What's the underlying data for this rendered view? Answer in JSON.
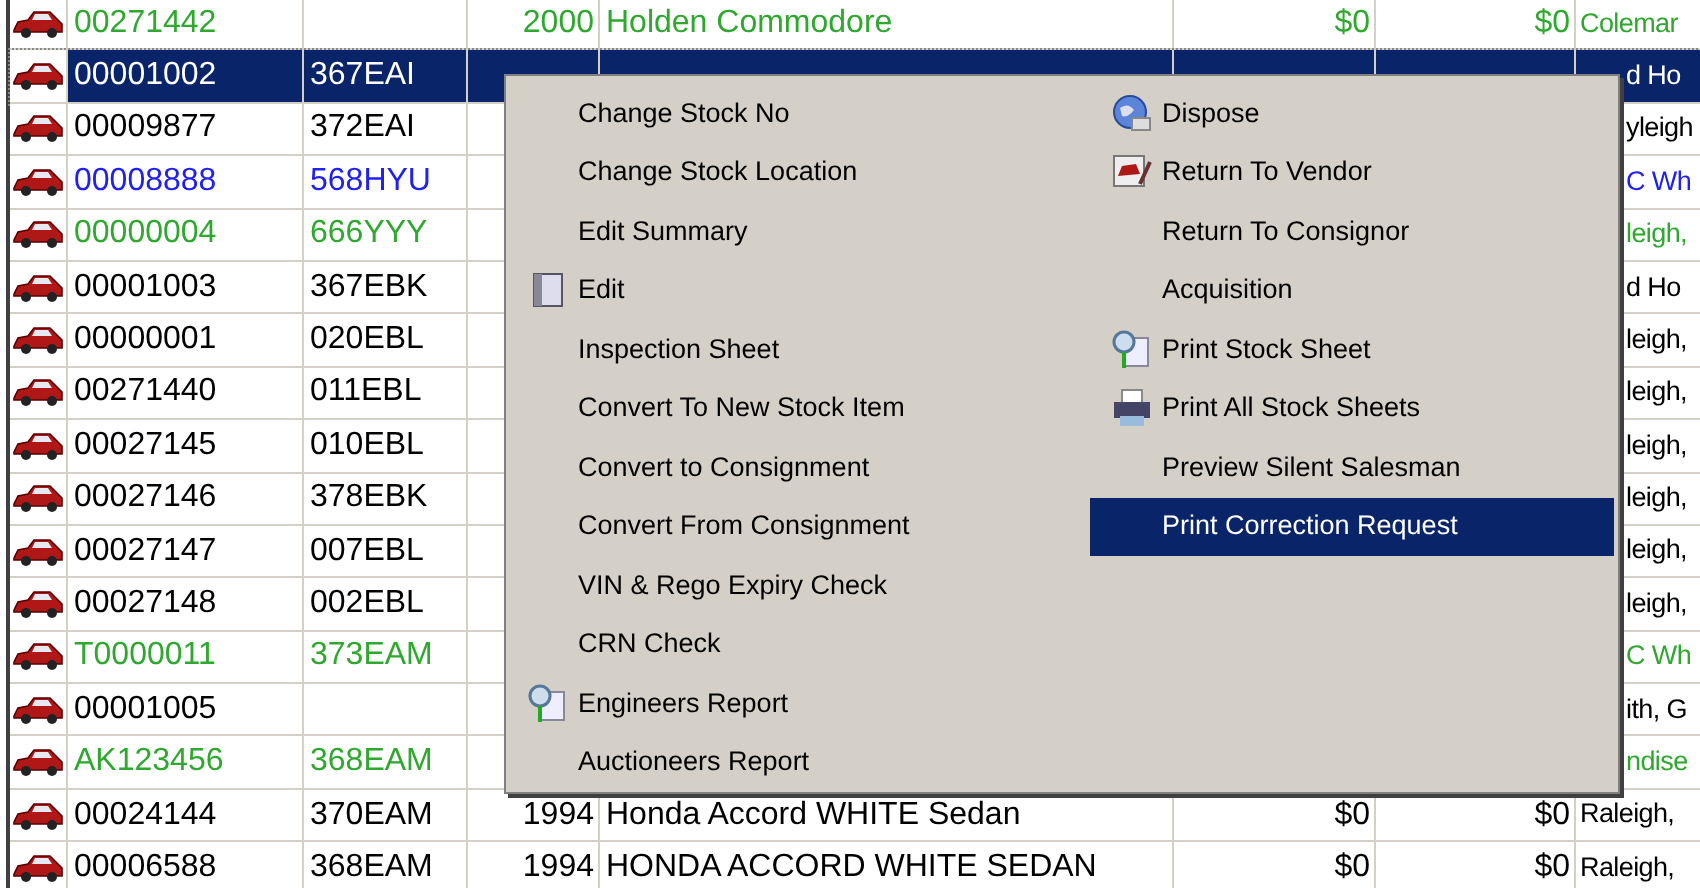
{
  "rows": [
    {
      "stock_no": "00271442",
      "rego": "",
      "year": "2000",
      "model": "Holden Commodore",
      "price_1": "$0",
      "price_2": "$0",
      "owner": "Colemar",
      "color": "#2ea82e",
      "selected": false,
      "covered": false
    },
    {
      "stock_no": "00001002",
      "rego": "367EAI",
      "owner": "d Ho",
      "selected": true,
      "covered": true
    },
    {
      "stock_no": "00009877",
      "rego": "372EAI",
      "owner": "yleigh",
      "color": "#000000",
      "selected": false,
      "covered": true
    },
    {
      "stock_no": "00008888",
      "rego": "568HYU",
      "owner": "C Wh",
      "color": "#2020f0",
      "selected": false,
      "covered": true
    },
    {
      "stock_no": "00000004",
      "rego": "666YYY",
      "owner": "leigh,",
      "color": "#2ea82e",
      "selected": false,
      "covered": true
    },
    {
      "stock_no": "00001003",
      "rego": "367EBK",
      "owner": "d Ho",
      "color": "#000000",
      "selected": false,
      "covered": true
    },
    {
      "stock_no": "00000001",
      "rego": "020EBL",
      "owner": "leigh,",
      "color": "#000000",
      "selected": false,
      "covered": true
    },
    {
      "stock_no": "00271440",
      "rego": "011EBL",
      "owner": "leigh,",
      "color": "#000000",
      "selected": false,
      "covered": true
    },
    {
      "stock_no": "00027145",
      "rego": "010EBL",
      "owner": "leigh,",
      "color": "#000000",
      "selected": false,
      "covered": true
    },
    {
      "stock_no": "00027146",
      "rego": "378EBK",
      "owner": "leigh,",
      "color": "#000000",
      "selected": false,
      "covered": true
    },
    {
      "stock_no": "00027147",
      "rego": "007EBL",
      "owner": "leigh,",
      "color": "#000000",
      "selected": false,
      "covered": true
    },
    {
      "stock_no": "00027148",
      "rego": "002EBL",
      "owner": "leigh,",
      "color": "#000000",
      "selected": false,
      "covered": true
    },
    {
      "stock_no": "T0000011",
      "rego": "373EAM",
      "owner": "C Wh",
      "color": "#2ea82e",
      "selected": false,
      "covered": true
    },
    {
      "stock_no": "00001005",
      "rego": "",
      "owner": "ith, G",
      "color": "#000000",
      "selected": false,
      "covered": true
    },
    {
      "stock_no": "AK123456",
      "rego": "368EAM",
      "owner": "ndise",
      "color": "#2ea82e",
      "selected": false,
      "covered": true
    },
    {
      "stock_no": "00024144",
      "rego": "370EAM",
      "year": "1994",
      "model": "Honda Accord  WHITE Sedan",
      "price_1": "$0",
      "price_2": "$0",
      "owner": "Raleigh,",
      "color": "#000000",
      "selected": false,
      "covered": false
    },
    {
      "stock_no": "00006588",
      "rego": "368EAM",
      "year": "1994",
      "model": "HONDA ACCORD  WHITE SEDAN",
      "price_1": "$0",
      "price_2": "$0",
      "owner": "Raleigh,",
      "color": "#000000",
      "selected": false,
      "covered": false
    }
  ],
  "context_menu": {
    "columns": [
      [
        {
          "label": "Change Stock No",
          "kind": "plain",
          "selected": false
        },
        {
          "label": "Change Stock Location",
          "kind": "plain",
          "selected": false
        },
        {
          "label": "Edit Summary",
          "kind": "plain",
          "selected": false
        },
        {
          "label": "Edit",
          "kind": "icon",
          "selected": false
        },
        {
          "label": "Inspection Sheet",
          "kind": "plain",
          "selected": false
        },
        {
          "label": "Convert To New Stock Item",
          "kind": "plain",
          "selected": false
        },
        {
          "label": "Convert to Consignment",
          "kind": "plain",
          "selected": false
        },
        {
          "label": "Convert From Consignment",
          "kind": "plain",
          "selected": false
        },
        {
          "label": "VIN & Rego Expiry Check",
          "kind": "plain",
          "selected": false
        },
        {
          "label": "CRN Check",
          "kind": "plain",
          "selected": false
        },
        {
          "label": "Engineers Report",
          "kind": "icon",
          "selected": false
        },
        {
          "label": "Auctioneers Report",
          "kind": "plain",
          "selected": false
        }
      ],
      [
        {
          "label": "Dispose",
          "kind": "icon",
          "selected": false
        },
        {
          "label": "Return To Vendor",
          "kind": "icon",
          "selected": false
        },
        {
          "label": "Return To Consignor",
          "kind": "plain",
          "selected": false
        },
        {
          "label": "Acquisition",
          "kind": "plain",
          "selected": false
        },
        {
          "label": "Print Stock Sheet",
          "kind": "icon",
          "selected": false
        },
        {
          "label": "Print All Stock Sheets",
          "kind": "icon",
          "selected": false
        },
        {
          "label": "Preview Silent Salesman",
          "kind": "plain",
          "selected": false
        },
        {
          "label": "Print Correction Request",
          "kind": "plain",
          "selected": true
        }
      ]
    ]
  }
}
